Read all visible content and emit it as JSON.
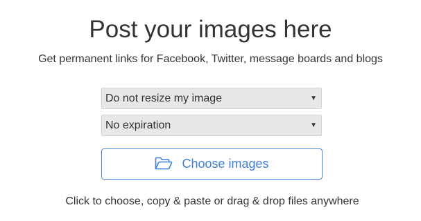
{
  "header": {
    "title": "Post your images here",
    "subtitle": "Get permanent links for Facebook, Twitter, message boards and blogs"
  },
  "form": {
    "resize_select": {
      "selected": "Do not resize my image"
    },
    "expiration_select": {
      "selected": "No expiration"
    },
    "choose_button": {
      "label": "Choose images",
      "icon": "folder-open-icon"
    },
    "hint": "Click to choose, copy & paste or drag & drop files anywhere"
  },
  "colors": {
    "accent": "#3f7fd4",
    "button_border": "#4a87d6",
    "select_background": "#e8e8e8",
    "text": "#333333"
  }
}
